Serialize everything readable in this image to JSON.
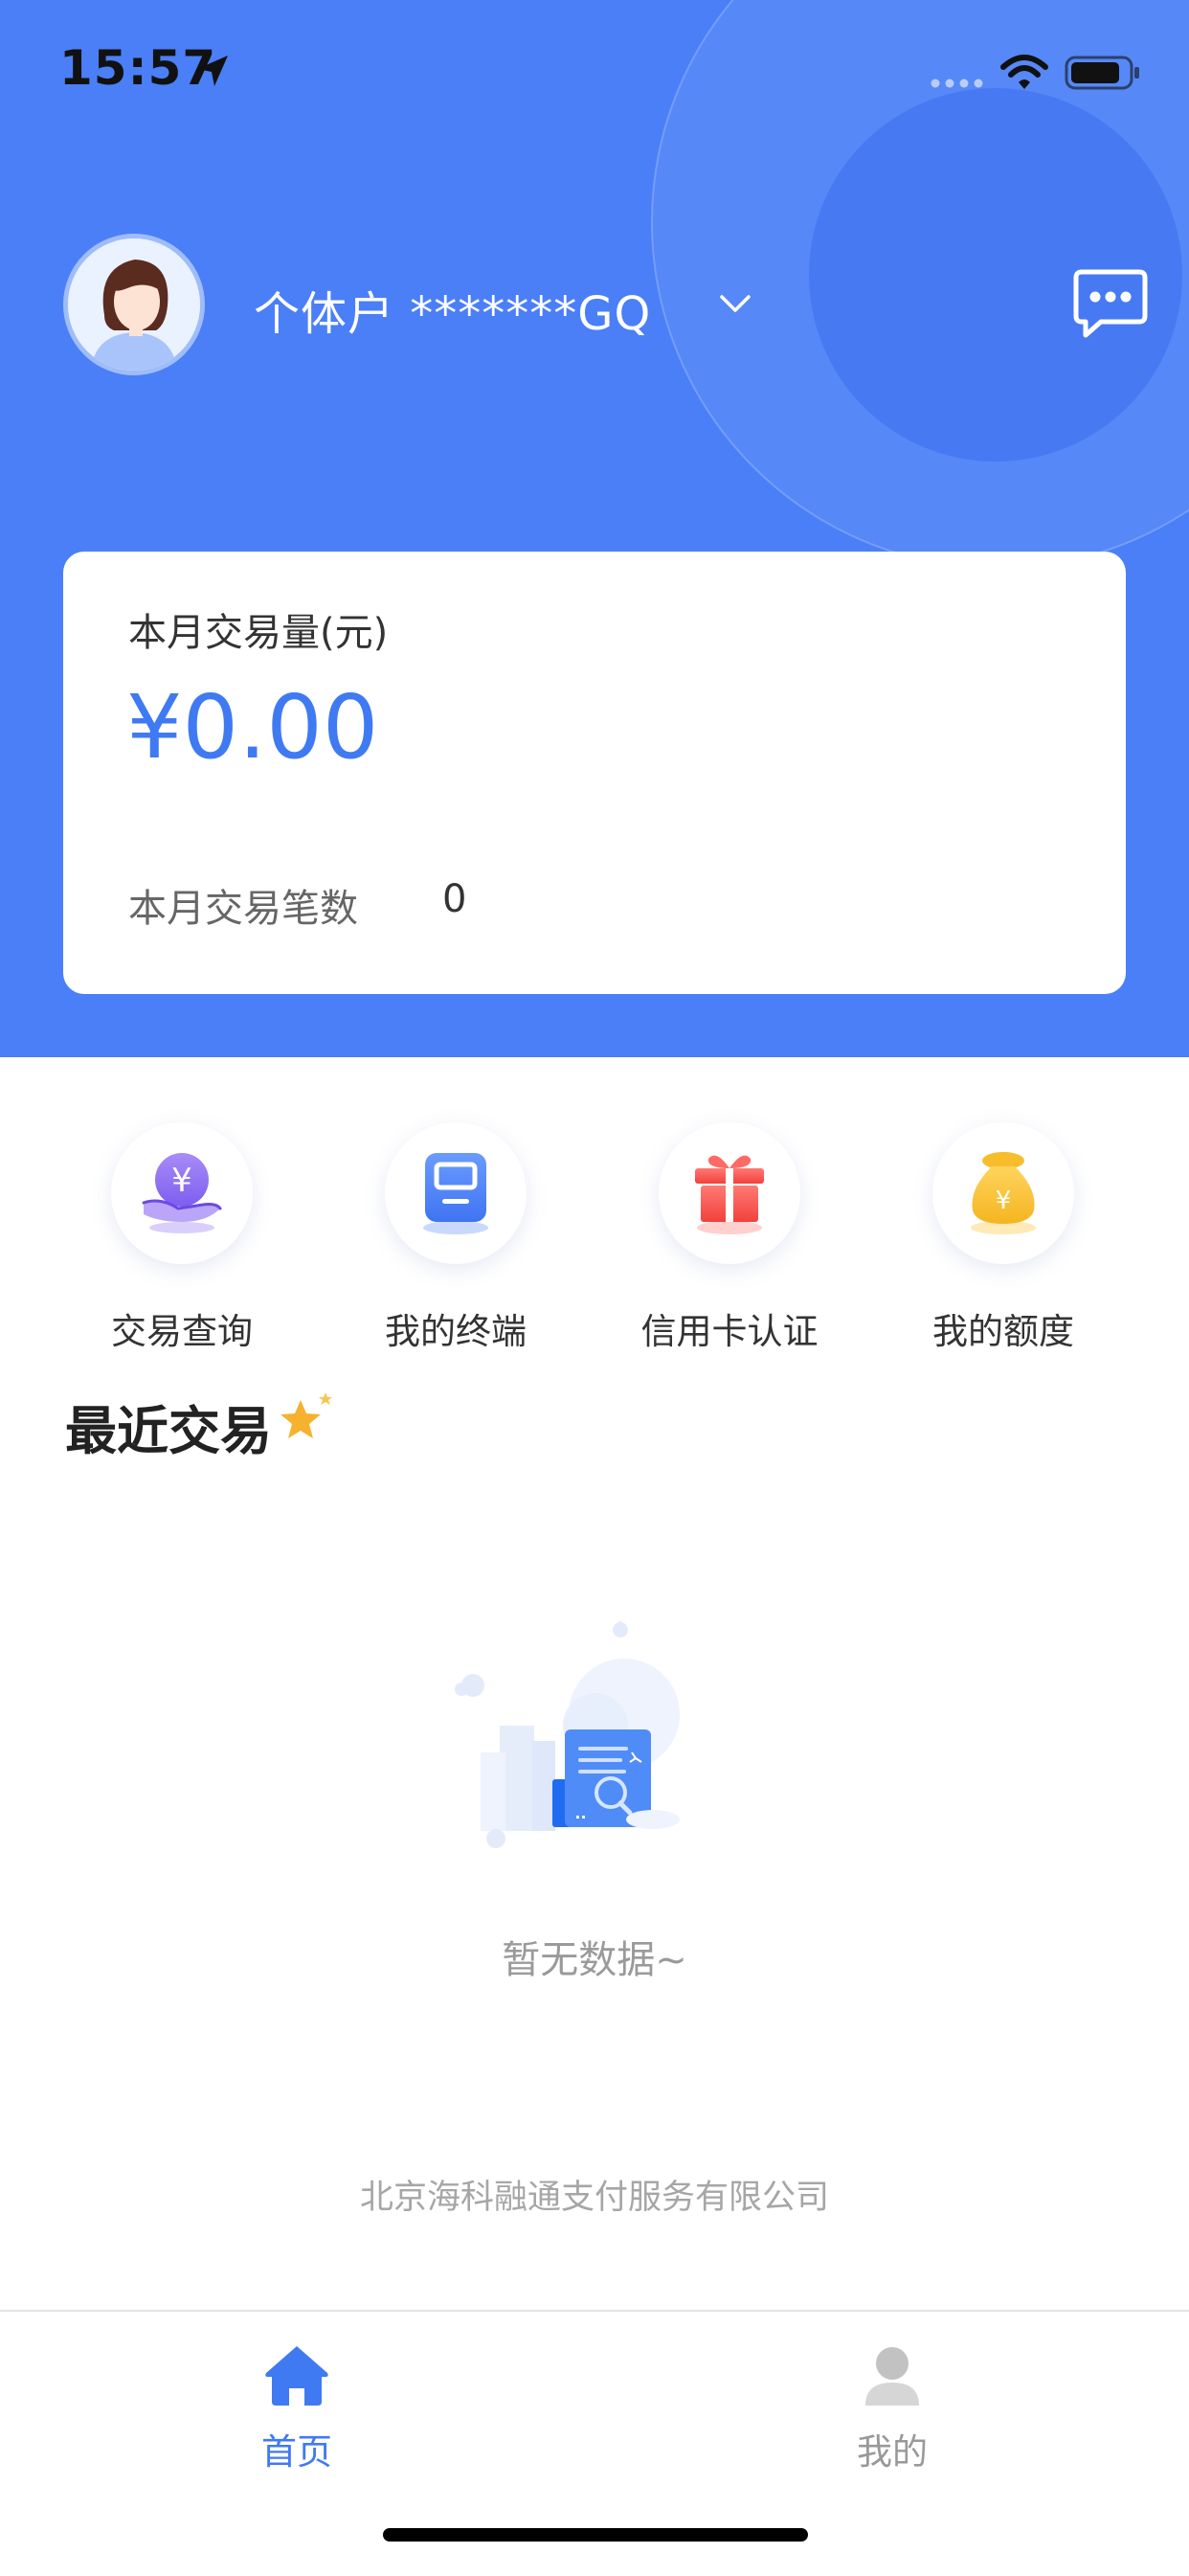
{
  "status_bar": {
    "time": "15:57"
  },
  "header": {
    "account_name": "个体户 *******GQ",
    "avatar_icon": "avatar-icon",
    "message_icon": "message-icon",
    "brand_color": "#4a7ff7"
  },
  "summary": {
    "month_volume_label": "本月交易量(元)",
    "month_volume_value": "¥0.00",
    "month_count_label": "本月交易笔数",
    "month_count_value": "0",
    "amount_color": "#3f7af3"
  },
  "quick_actions": [
    {
      "label": "交易查询",
      "icon": "yuan-hand-icon"
    },
    {
      "label": "我的终端",
      "icon": "terminal-icon"
    },
    {
      "label": "信用卡认证",
      "icon": "gift-icon"
    },
    {
      "label": "我的额度",
      "icon": "money-bag-icon"
    }
  ],
  "recent": {
    "title": "最近交易",
    "empty_text": "暂无数据~"
  },
  "footer": {
    "company": "北京海科融通支付服务有限公司"
  },
  "tabs": [
    {
      "label": "首页",
      "icon": "home-icon",
      "active": true,
      "color": "#3f7af3"
    },
    {
      "label": "我的",
      "icon": "user-icon",
      "active": false,
      "color": "#999999"
    }
  ]
}
